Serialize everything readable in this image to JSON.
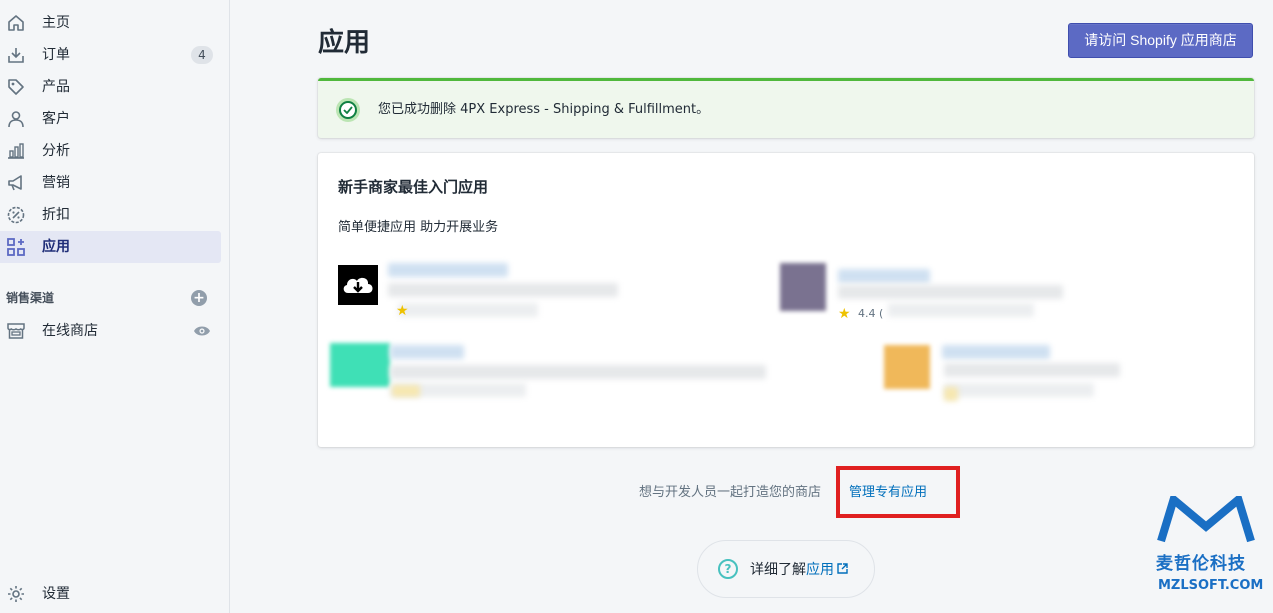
{
  "sidebar": {
    "items": [
      {
        "label": "主页",
        "icon": "home-icon"
      },
      {
        "label": "订单",
        "icon": "orders-icon",
        "badge": "4"
      },
      {
        "label": "产品",
        "icon": "tag-icon"
      },
      {
        "label": "客户",
        "icon": "person-icon"
      },
      {
        "label": "分析",
        "icon": "bar-chart-icon"
      },
      {
        "label": "营销",
        "icon": "megaphone-icon"
      },
      {
        "label": "折扣",
        "icon": "discount-icon"
      },
      {
        "label": "应用",
        "icon": "apps-icon",
        "active": true
      }
    ],
    "channels_title": "销售渠道",
    "online_store": "在线商店",
    "settings": "设置"
  },
  "header": {
    "title": "应用",
    "visit_store_button": "请访问 Shopify 应用商店"
  },
  "banner": {
    "message": "您已成功删除 4PX Express - Shipping & Fulfillment。",
    "status_color": "#50b83c"
  },
  "card": {
    "title": "新手商家最佳入门应用",
    "subtitle": "简单便捷应用 助力开展业务",
    "apps": [
      {
        "rating": ""
      },
      {
        "rating": "4.4 ("
      },
      {
        "rating": ""
      },
      {
        "rating": ""
      }
    ]
  },
  "footer": {
    "prompt": "想与开发人员一起打造您的商店",
    "manage_link": "管理专有应用",
    "learn_prefix": "详细了解",
    "learn_link": "应用"
  },
  "watermark": {
    "company": "麦哲伦科技",
    "site": "MZLSOFT.COM"
  },
  "colors": {
    "primary": "#5c6ac4",
    "link": "#006fbb",
    "success": "#50b83c",
    "highlight": "#e02020"
  }
}
